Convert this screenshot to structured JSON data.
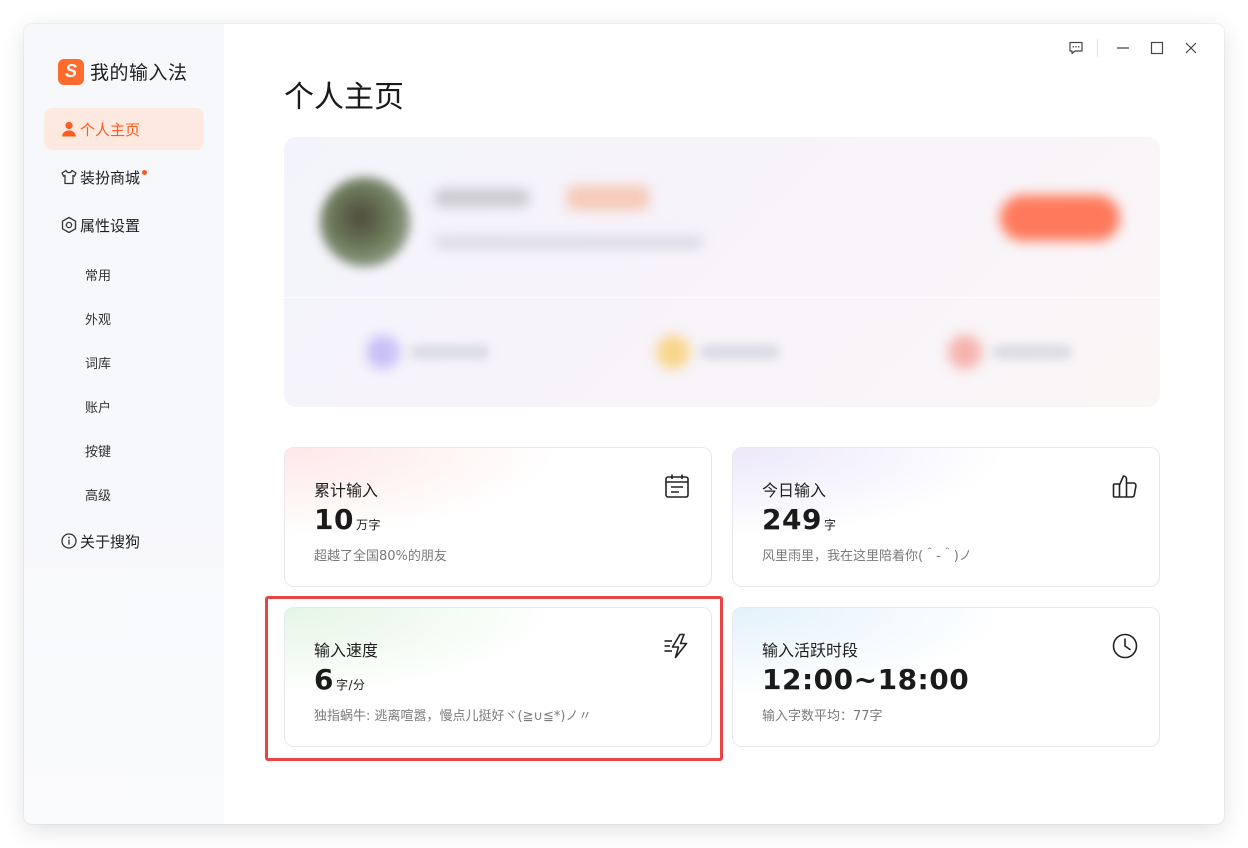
{
  "app": {
    "name": "我的输入法",
    "logo_letter": "S",
    "accent": "#ff5a1f"
  },
  "sidebar": {
    "items": [
      {
        "label": "个人主页",
        "icon": "user-icon",
        "active": true
      },
      {
        "label": "装扮商城",
        "icon": "shirt-icon",
        "badge_dot": true
      },
      {
        "label": "属性设置",
        "icon": "settings-hex-icon"
      }
    ],
    "sub_items": [
      "常用",
      "外观",
      "词库",
      "账户",
      "按键",
      "高级"
    ],
    "about": {
      "label": "关于搜狗",
      "icon": "info-icon"
    }
  },
  "titlebar": {
    "buttons": [
      "feedback-icon",
      "minimize-icon",
      "maximize-icon",
      "close-icon"
    ]
  },
  "main": {
    "title": "个人主页",
    "stats": [
      {
        "label": "累计输入",
        "value": "10",
        "unit": "万字",
        "note": "超越了全国80%的朋友",
        "icon": "calendar-icon"
      },
      {
        "label": "今日输入",
        "value": "249",
        "unit": "字",
        "note": "风里雨里，我在这里陪着你(＾-＾)ノ",
        "icon": "thumbs-up-icon"
      },
      {
        "label": "输入速度",
        "value": "6",
        "unit": "字/分",
        "note": "独指蜗牛: 逃离喧嚣，慢点儿挺好ヾ(≧∪≦*)ノ〃",
        "icon": "lightning-icon"
      },
      {
        "label": "输入活跃时段",
        "value": "12:00~18:00",
        "unit": "",
        "note": "输入字数平均：77字",
        "icon": "clock-icon"
      }
    ]
  }
}
